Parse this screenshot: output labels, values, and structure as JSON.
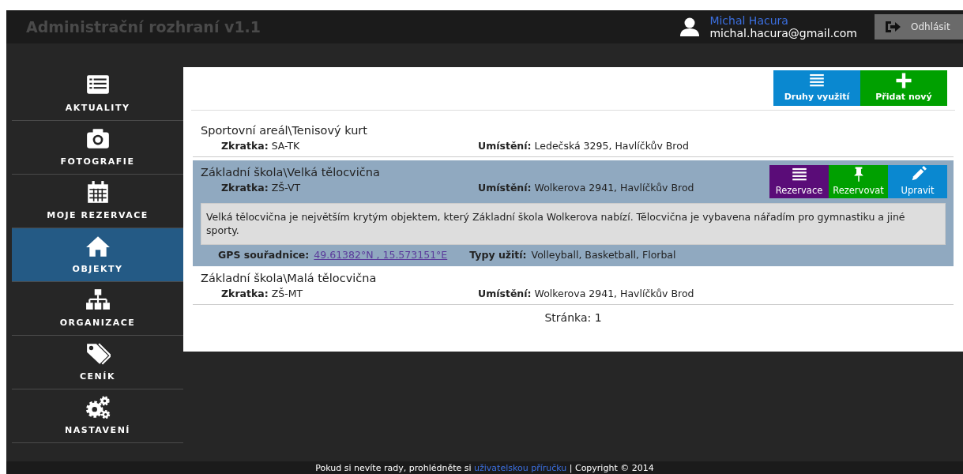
{
  "header": {
    "title": "Administrační rozhraní v1.1",
    "user_name": "Michal Hacura",
    "user_email": "michal.hacura@gmail.com",
    "logout": "Odhlásit"
  },
  "sidebar": {
    "items": [
      {
        "label": "AKTUALITY",
        "selected": false
      },
      {
        "label": "FOTOGRAFIE",
        "selected": false
      },
      {
        "label": "MOJE REZERVACE",
        "selected": false
      },
      {
        "label": "OBJEKTY",
        "selected": true
      },
      {
        "label": "ORGANIZACE",
        "selected": false
      },
      {
        "label": "CENÍK",
        "selected": false
      },
      {
        "label": "NASTAVENÍ",
        "selected": false
      }
    ]
  },
  "toolbar": [
    {
      "label": "Druhy využití"
    },
    {
      "label": "Přidat nový"
    }
  ],
  "objects": [
    {
      "name": "Sportovní areál\\Tenisový kurt",
      "abbr_label": "Zkratka:",
      "abbr": "SA-TK",
      "location_label": "Umístění:",
      "location": "Ledečská 3295, Havlíčkův Brod",
      "expanded": false
    },
    {
      "name": "Základní škola\\Velká tělocvična",
      "abbr_label": "Zkratka:",
      "abbr": "ZŠ-VT",
      "location_label": "Umístění:",
      "location": "Wolkerova 2941, Havlíčkův Brod",
      "expanded": true,
      "actions": [
        {
          "label": "Rezervace"
        },
        {
          "label": "Rezervovat"
        },
        {
          "label": "Upravit"
        }
      ],
      "description": "Velká tělocvična je největším krytým objektem, který Základní škola Wolkerova nabízí. Tělocvična je vybavena nářadím pro gymnastiku a jiné sporty.",
      "gps_label": "GPS souřadnice:",
      "gps": "49.61382°N , 15.573151°E",
      "types_label": "Typy užití:",
      "types": "Volleyball, Basketball, Florbal"
    },
    {
      "name": "Základní škola\\Malá tělocvična",
      "abbr_label": "Zkratka:",
      "abbr": "ZŠ-MT",
      "location_label": "Umístění:",
      "location": "Wolkerova 2941, Havlíčkův Brod",
      "expanded": false
    }
  ],
  "pagination": "Stránka: 1",
  "footer": {
    "text": "Pokud si nevíte rady, prohlédněte si",
    "link": "uživatelskou příručku",
    "copyright": "| Copyright © 2014"
  }
}
